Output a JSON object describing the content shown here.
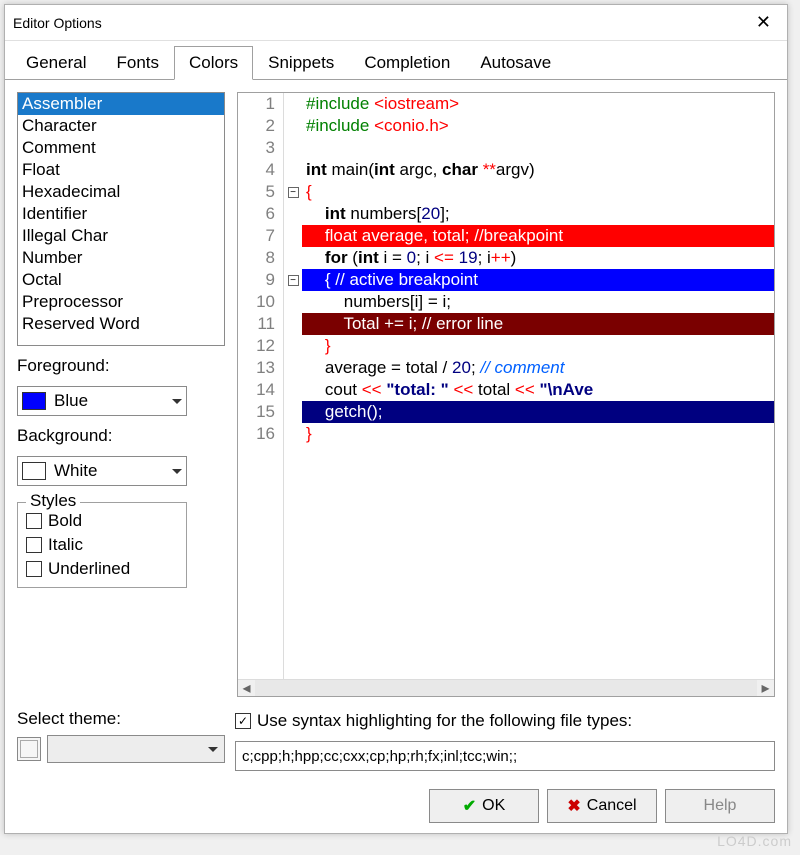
{
  "window": {
    "title": "Editor Options"
  },
  "tabs": [
    "General",
    "Fonts",
    "Colors",
    "Snippets",
    "Completion",
    "Autosave"
  ],
  "active_tab_index": 2,
  "syntax_items": [
    "Assembler",
    "Character",
    "Comment",
    "Float",
    "Hexadecimal",
    "Identifier",
    "Illegal Char",
    "Number",
    "Octal",
    "Preprocessor",
    "Reserved Word"
  ],
  "selected_syntax_index": 0,
  "foreground": {
    "label": "Foreground:",
    "value": "Blue",
    "swatch": "#0000ff"
  },
  "background": {
    "label": "Background:",
    "value": "White",
    "swatch": "#ffffff"
  },
  "styles": {
    "legend": "Styles",
    "bold": {
      "label": "Bold",
      "checked": false
    },
    "italic": {
      "label": "Italic",
      "checked": false
    },
    "underlined": {
      "label": "Underlined",
      "checked": false
    }
  },
  "syntax_highlight": {
    "checked": true,
    "label": "Use syntax highlighting for the following file types:",
    "filetypes": "c;cpp;h;hpp;cc;cxx;cp;hp;rh;fx;inl;tcc;win;;"
  },
  "theme": {
    "label": "Select theme:",
    "value": ""
  },
  "buttons": {
    "ok": "OK",
    "cancel": "Cancel",
    "help": "Help"
  },
  "code": {
    "lines": 16,
    "fold_minus_at": [
      5,
      9
    ],
    "tokens": [
      [
        [
          "tok-green",
          "#include "
        ],
        [
          "tok-red",
          "<iostream>"
        ]
      ],
      [
        [
          "tok-green",
          "#include "
        ],
        [
          "tok-red",
          "<conio.h>"
        ]
      ],
      [],
      [
        [
          "tok-black",
          "int "
        ],
        [
          "tok-n",
          "main("
        ],
        [
          "tok-black",
          "int "
        ],
        [
          "tok-n",
          "argc, "
        ],
        [
          "tok-black",
          "char "
        ],
        [
          "tok-red",
          "**"
        ],
        [
          "tok-n",
          "argv)"
        ]
      ],
      [
        [
          "tok-red",
          "{"
        ]
      ],
      [
        [
          "plain",
          "    "
        ],
        [
          "tok-black",
          "int "
        ],
        [
          "tok-n",
          "numbers["
        ],
        [
          "tok-num",
          "20"
        ],
        [
          "tok-n",
          "];"
        ]
      ],
      [
        [
          "plain",
          "    "
        ],
        [
          "hl-red-full",
          "float average, total; //breakpoint"
        ]
      ],
      [
        [
          "plain",
          "    "
        ],
        [
          "tok-black",
          "for "
        ],
        [
          "tok-n",
          "("
        ],
        [
          "tok-black",
          "int "
        ],
        [
          "tok-n",
          "i = "
        ],
        [
          "tok-num",
          "0"
        ],
        [
          "tok-n",
          "; i "
        ],
        [
          "tok-red",
          "<="
        ],
        [
          "tok-n",
          " "
        ],
        [
          "tok-num",
          "19"
        ],
        [
          "tok-n",
          "; i"
        ],
        [
          "tok-red",
          "++"
        ],
        [
          "tok-n",
          ")"
        ]
      ],
      [
        [
          "hl-blue-full",
          "    { // active breakpoint"
        ]
      ],
      [
        [
          "plain",
          "        numbers[i] = i;"
        ]
      ],
      [
        [
          "hl-maroon-full",
          "        Total += i; // error line"
        ]
      ],
      [
        [
          "plain",
          "    "
        ],
        [
          "tok-red",
          "}"
        ]
      ],
      [
        [
          "plain",
          "    average = total / "
        ],
        [
          "tok-num",
          "20"
        ],
        [
          "tok-n",
          "; "
        ],
        [
          "tok-comment",
          "// comment"
        ]
      ],
      [
        [
          "plain",
          "    cout "
        ],
        [
          "tok-red",
          "<< "
        ],
        [
          "tok-navy",
          "\"total: \""
        ],
        [
          "tok-n",
          " "
        ],
        [
          "tok-red",
          "<<"
        ],
        [
          "tok-n",
          " total "
        ],
        [
          "tok-red",
          "<< "
        ],
        [
          "tok-navy",
          "\"\\nAve"
        ]
      ],
      [
        [
          "hl-navy-full",
          "    getch();"
        ]
      ],
      [
        [
          "tok-red",
          "}"
        ]
      ]
    ]
  },
  "watermark": "LO4D.com"
}
